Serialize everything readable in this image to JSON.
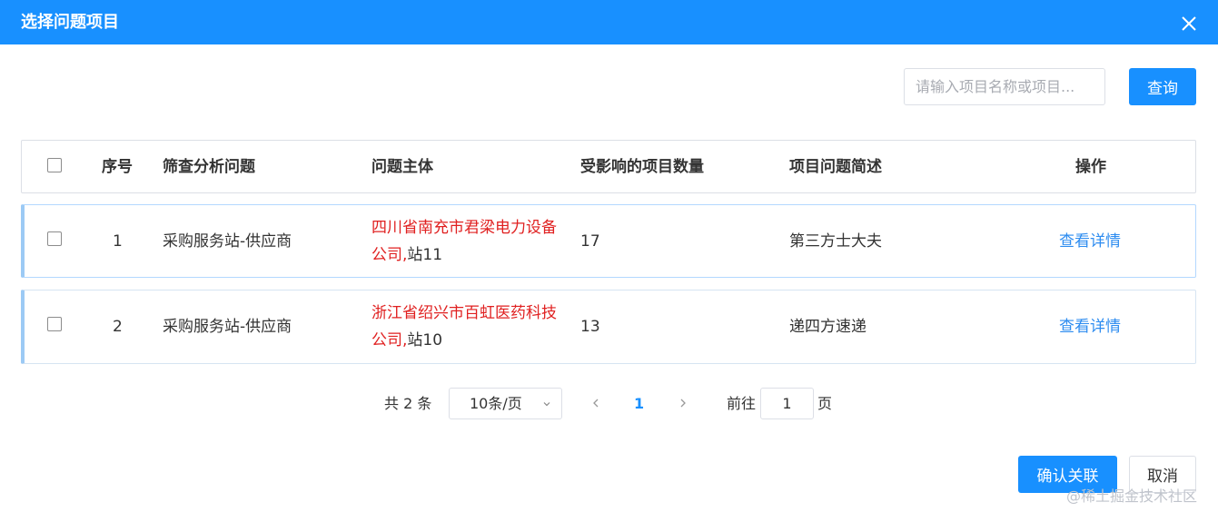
{
  "dialog": {
    "title": "选择问题项目",
    "close_icon": "close-icon"
  },
  "search": {
    "placeholder": "请输入项目名称或项目...",
    "button_label": "查询"
  },
  "table": {
    "columns": [
      "序号",
      "筛查分析问题",
      "问题主体",
      "受影响的项目数量",
      "项目问题简述",
      "操作"
    ],
    "rows": [
      {
        "index": "1",
        "issue": "采购服务站-供应商",
        "subject_company": "四川省南充市君梁电力设备公司,",
        "subject_station": "站11",
        "affected_count": "17",
        "summary": "第三方士大夫",
        "action": "查看详情"
      },
      {
        "index": "2",
        "issue": "采购服务站-供应商",
        "subject_company": "浙江省绍兴市百虹医药科技公司,",
        "subject_station": "站10",
        "affected_count": "13",
        "summary": "递四方速递",
        "action": "查看详情"
      }
    ]
  },
  "pagination": {
    "total": "共 2 条",
    "page_size": "10条/页",
    "current_page": "1",
    "goto_label": "前往",
    "goto_value": "1",
    "page_suffix": "页"
  },
  "footer": {
    "confirm_label": "确认关联",
    "cancel_label": "取消"
  },
  "watermark": "@稀土掘金技术社区",
  "colors": {
    "primary": "#1890ff",
    "subject_red": "#e02020",
    "link_blue": "#2d8cf0"
  }
}
